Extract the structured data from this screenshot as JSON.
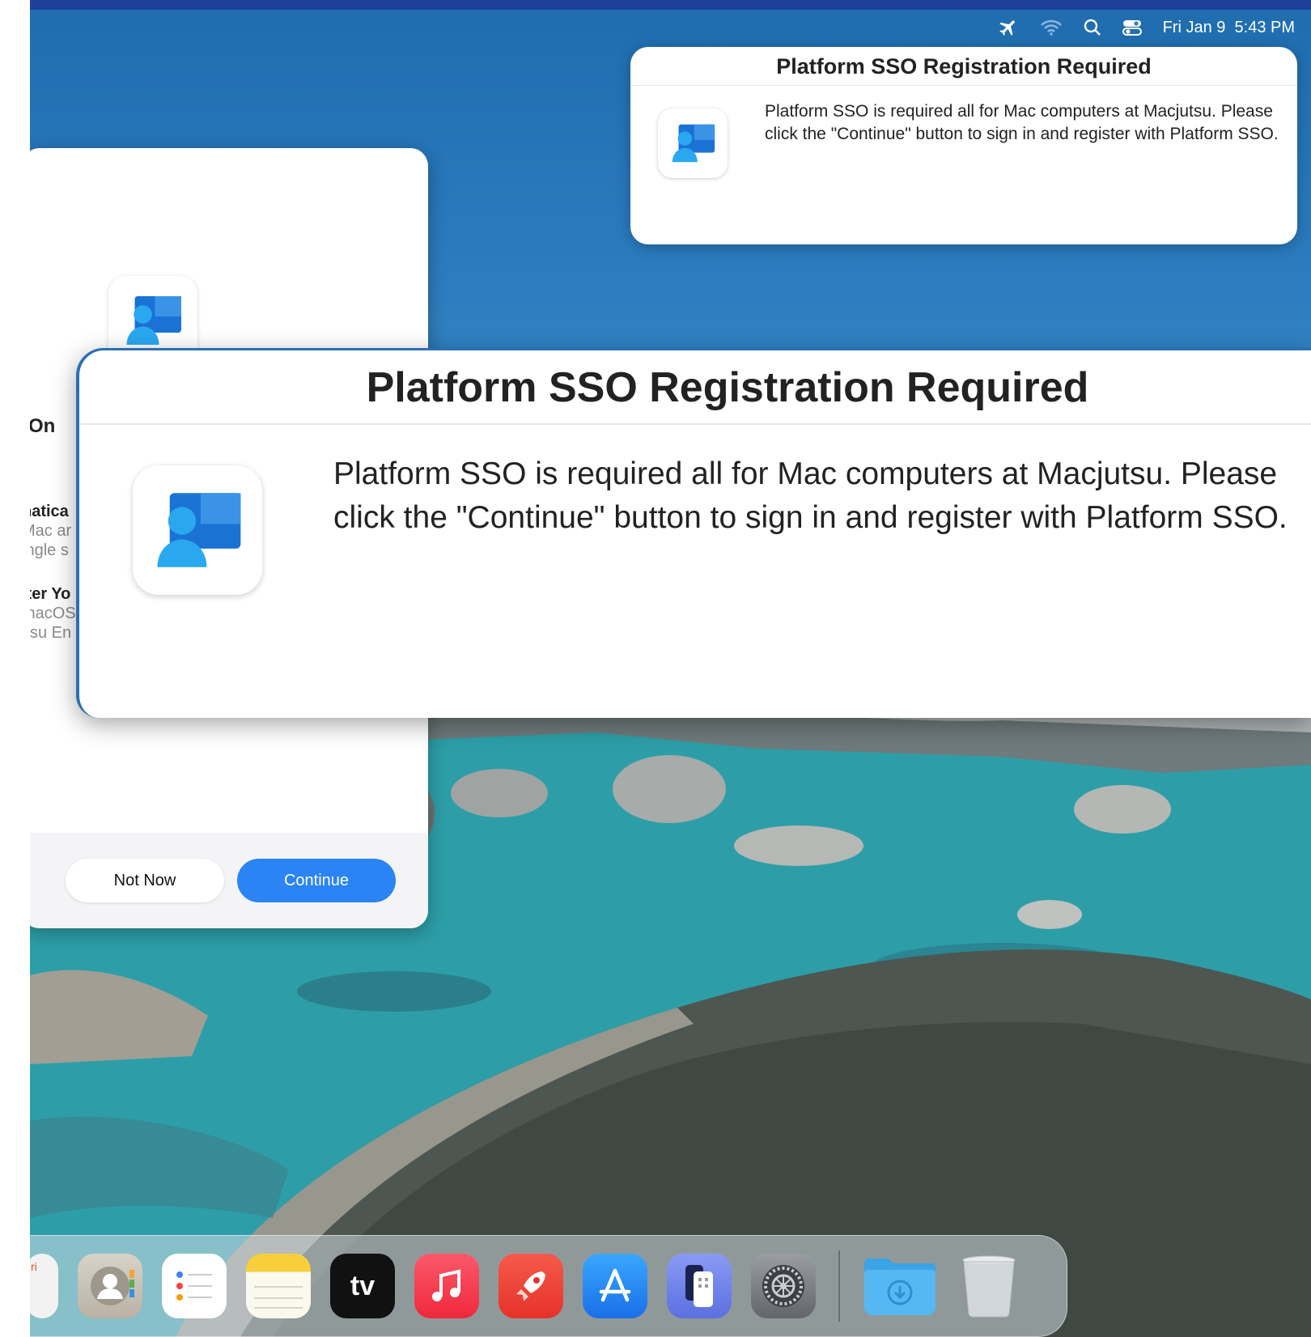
{
  "menubar": {
    "date": "Fri Jan 9",
    "time": "5:43 PM",
    "icons": [
      "airplane-icon",
      "wifi-icon",
      "search-icon",
      "control-center-icon"
    ]
  },
  "notification": {
    "title": "Platform SSO Registration Required",
    "body": "Platform SSO is required all for Mac computers at Macjutsu. Please click the \"Continue\" button to sign in and register with Platform SSO."
  },
  "background_dialog": {
    "fragments": [
      "-On",
      "natica",
      "Mac ar",
      "ingle s",
      "iter Yo",
      "macOS",
      "itsu En"
    ],
    "not_now_label": "Not Now",
    "continue_label": "Continue"
  },
  "zoomed_dialog": {
    "title": "Platform SSO Registration Required",
    "body": "Platform SSO is required all for Mac computers at Macjutsu. Please click the \"Continue\" button to sign in and register with Platform SSO."
  },
  "dock": {
    "safari_fragment": "ri",
    "apps": [
      {
        "name": "Contacts",
        "icon": "contacts-icon"
      },
      {
        "name": "Reminders",
        "icon": "reminders-icon"
      },
      {
        "name": "Notes",
        "icon": "notes-icon"
      },
      {
        "name": "TV",
        "icon": "apple-tv-icon",
        "label": "tv"
      },
      {
        "name": "Music",
        "icon": "music-icon"
      },
      {
        "name": "Launchpad",
        "icon": "rocket-icon"
      },
      {
        "name": "App Store",
        "icon": "app-store-icon"
      },
      {
        "name": "iPhone Mirroring",
        "icon": "iphone-mirroring-icon"
      },
      {
        "name": "System Settings",
        "icon": "settings-gear-icon"
      },
      {
        "name": "Downloads",
        "icon": "downloads-folder-icon"
      },
      {
        "name": "Trash",
        "icon": "trash-icon"
      }
    ]
  },
  "colors": {
    "accent": "#2a84f3",
    "menubar_strip": "#1e3f9a",
    "company_portal_blue": "#1a73d4"
  }
}
